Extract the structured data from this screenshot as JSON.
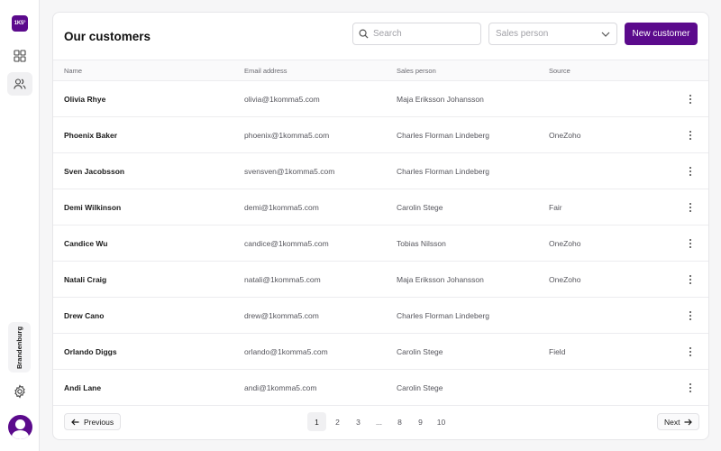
{
  "sidebar": {
    "logo": "1K5°",
    "region": "Brandenburg",
    "icons": [
      "dashboard-icon",
      "users-icon",
      "gear-icon"
    ]
  },
  "header": {
    "title": "Our customers",
    "search_placeholder": "Search",
    "sales_person_placeholder": "Sales person",
    "new_customer_label": "New customer"
  },
  "table": {
    "columns": [
      "Name",
      "Email address",
      "Sales person",
      "Source"
    ],
    "rows": [
      {
        "name": "Olivia Rhye",
        "email": "olivia@1komma5.com",
        "sales": "Maja Eriksson Johansson",
        "source": ""
      },
      {
        "name": "Phoenix Baker",
        "email": "phoenix@1komma5.com",
        "sales": "Charles Florman Lindeberg",
        "source": "OneZoho"
      },
      {
        "name": "Sven Jacobsson",
        "email": "svensven@1komma5.com",
        "sales": "Charles Florman Lindeberg",
        "source": ""
      },
      {
        "name": "Demi Wilkinson",
        "email": "demi@1komma5.com",
        "sales": "Carolin Stege",
        "source": "Fair"
      },
      {
        "name": "Candice Wu",
        "email": "candice@1komma5.com",
        "sales": "Tobias Nilsson",
        "source": "OneZoho"
      },
      {
        "name": "Natali Craig",
        "email": "natali@1komma5.com",
        "sales": "Maja Eriksson Johansson",
        "source": "OneZoho"
      },
      {
        "name": "Drew Cano",
        "email": "drew@1komma5.com",
        "sales": "Charles Florman Lindeberg",
        "source": ""
      },
      {
        "name": "Orlando Diggs",
        "email": "orlando@1komma5.com",
        "sales": "Carolin Stege",
        "source": "Field"
      },
      {
        "name": "Andi Lane",
        "email": "andi@1komma5.com",
        "sales": "Carolin Stege",
        "source": ""
      }
    ]
  },
  "pagination": {
    "previous_label": "Previous",
    "next_label": "Next",
    "pages": [
      "1",
      "2",
      "3",
      "...",
      "8",
      "9",
      "10"
    ],
    "current": "1"
  }
}
